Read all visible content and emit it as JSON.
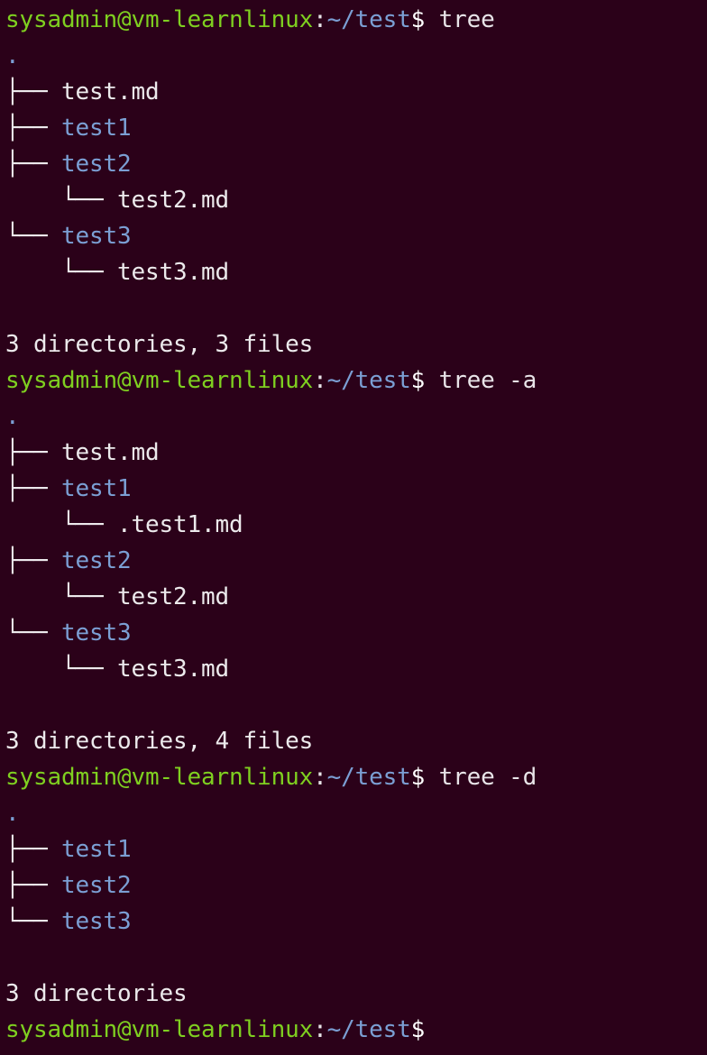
{
  "terminal": {
    "colors": {
      "background": "#2b0119",
      "prompt_user": "#7fd020",
      "prompt_path": "#7b9fd4",
      "prompt_dollar": "#ffffff",
      "directory": "#7b9fd4",
      "file": "#eceaec",
      "branch": "#ece9ec",
      "text": "#e8e4e8"
    },
    "prompt": {
      "user_host": "sysadmin@vm-learnlinux",
      "colon": ":",
      "path": "~/test",
      "dollar": "$"
    },
    "branch_glyphs": {
      "tee": "├──",
      "elbow": "└──",
      "pipe": "│",
      "blank": "   "
    },
    "blocks": [
      {
        "command": "tree",
        "root": ".",
        "entries": [
          {
            "indent": "",
            "connector": "├── ",
            "name": "test.md",
            "kind": "file"
          },
          {
            "indent": "",
            "connector": "├── ",
            "name": "test1",
            "kind": "dir"
          },
          {
            "indent": "",
            "connector": "├── ",
            "name": "test2",
            "kind": "dir"
          },
          {
            "indent": "    ",
            "connector": "└── ",
            "name": "test2.md",
            "kind": "file"
          },
          {
            "indent": "",
            "connector": "└── ",
            "name": "test3",
            "kind": "dir"
          },
          {
            "indent": "    ",
            "connector": "└── ",
            "name": "test3.md",
            "kind": "file"
          }
        ],
        "summary": "3 directories, 3 files"
      },
      {
        "command": "tree -a",
        "root": ".",
        "entries": [
          {
            "indent": "",
            "connector": "├── ",
            "name": "test.md",
            "kind": "file"
          },
          {
            "indent": "",
            "connector": "├── ",
            "name": "test1",
            "kind": "dir"
          },
          {
            "indent": "    ",
            "connector": "└── ",
            "name": ".test1.md",
            "kind": "file"
          },
          {
            "indent": "",
            "connector": "├── ",
            "name": "test2",
            "kind": "dir"
          },
          {
            "indent": "    ",
            "connector": "└── ",
            "name": "test2.md",
            "kind": "file"
          },
          {
            "indent": "",
            "connector": "└── ",
            "name": "test3",
            "kind": "dir"
          },
          {
            "indent": "    ",
            "connector": "└── ",
            "name": "test3.md",
            "kind": "file"
          }
        ],
        "summary": "3 directories, 4 files"
      },
      {
        "command": "tree -d",
        "root": ".",
        "entries": [
          {
            "indent": "",
            "connector": "├── ",
            "name": "test1",
            "kind": "dir"
          },
          {
            "indent": "",
            "connector": "├── ",
            "name": "test2",
            "kind": "dir"
          },
          {
            "indent": "",
            "connector": "└── ",
            "name": "test3",
            "kind": "dir"
          }
        ],
        "summary": "3 directories"
      }
    ],
    "final_prompt": true
  }
}
